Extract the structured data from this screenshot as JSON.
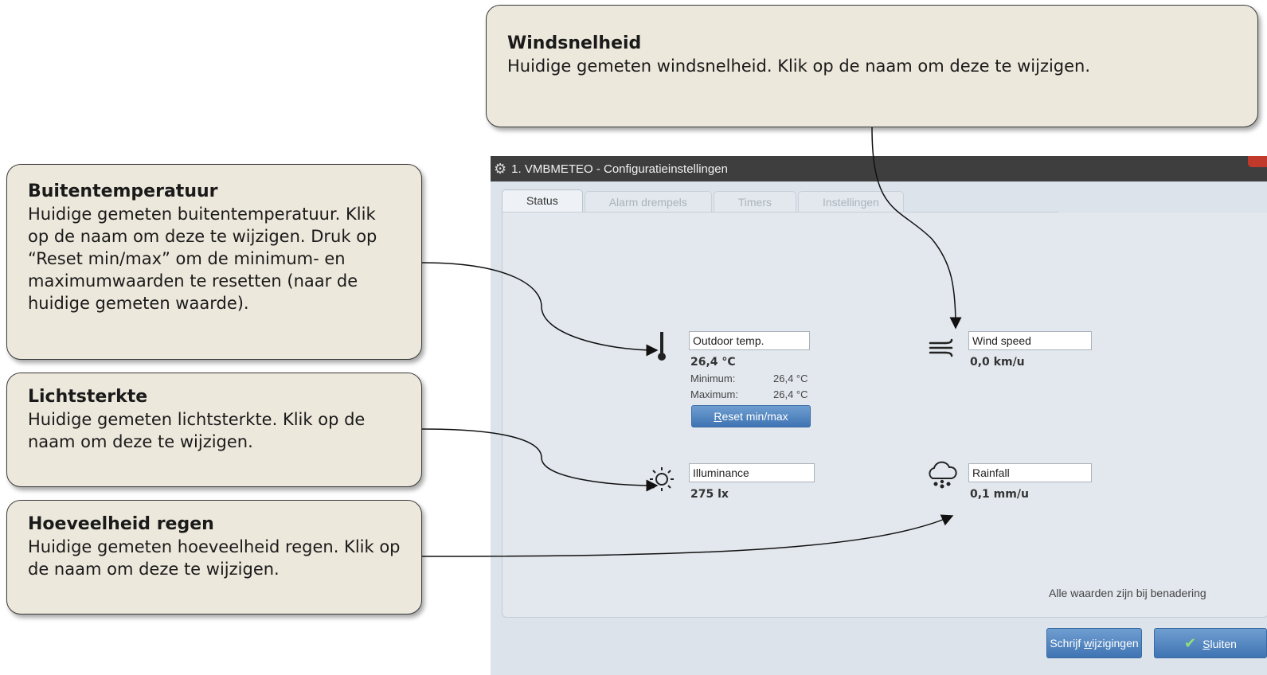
{
  "callouts": {
    "wind": {
      "title": "Windsnelheid",
      "body": "Huidige gemeten windsnelheid. Klik op de naam om deze te wijzigen."
    },
    "temp": {
      "title": "Buitentemperatuur",
      "body": "Huidige gemeten buitentemperatuur. Klik op de naam om deze te wijzigen. Druk op “Reset min/max” om de minimum- en maximumwaarden te resetten (naar de huidige gemeten waarde)."
    },
    "light": {
      "title": "Lichtsterkte",
      "body": "Huidige gemeten lichtsterkte. Klik op de naam om deze te wijzigen."
    },
    "rain": {
      "title": "Hoeveelheid regen",
      "body": "Huidige gemeten hoeveelheid regen. Klik op de naam om deze te wijzigen."
    }
  },
  "window": {
    "title": "1. VMBMETEO - Configuratieinstellingen",
    "tabs": [
      "Status",
      "Alarm drempels",
      "Timers",
      "Instellingen"
    ],
    "active_tab": "Status"
  },
  "sensors": {
    "temp": {
      "name": "Outdoor temp.",
      "value": "26,4 °C",
      "min_label": "Minimum:",
      "min_value": "26,4 °C",
      "max_label": "Maximum:",
      "max_value": "26,4 °C",
      "reset_label_u": "R",
      "reset_label_rest": "eset min/max"
    },
    "wind": {
      "name": "Wind speed",
      "value": "0,0 km/u"
    },
    "light": {
      "name": "Illuminance",
      "value": "275 lx"
    },
    "rain": {
      "name": "Rainfall",
      "value": "0,1 mm/u"
    }
  },
  "footer": {
    "approx_note": "Alle waarden zijn bij benadering",
    "write_pre": "Schrijf ",
    "write_u": "w",
    "write_post": "ijzigingen",
    "close_u": "S",
    "close_rest": "luiten"
  },
  "icons": [
    "gear-icon",
    "thermometer-icon",
    "wind-icon",
    "sun-icon",
    "rain-cloud-icon",
    "checkmark-icon"
  ],
  "colors": {
    "callout_bg": "#ede8dc",
    "titlebar": "#3e3e3e",
    "panel": "#e3e8ee",
    "button": "#4f85c2",
    "close": "#c0392b"
  }
}
